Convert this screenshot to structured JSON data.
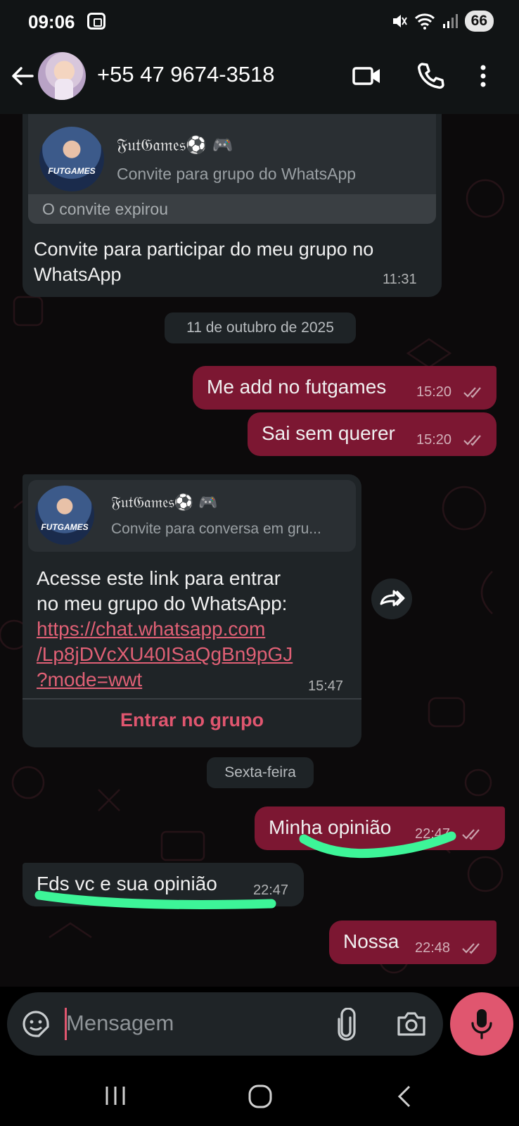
{
  "status": {
    "time": "09:06",
    "battery": "66"
  },
  "header": {
    "contact": "+55 47 9674-3518"
  },
  "messages": {
    "invite1": {
      "group_name": "𝔉𝔲𝔱𝔊𝔞𝔪𝔢𝔰⚽ 🎮",
      "subtitle": "Convite para grupo do WhatsApp",
      "thumb_label": "FUTGAMES",
      "expired": "O convite expirou",
      "text_line1": "Convite para participar do meu grupo no",
      "text_line2": "WhatsApp",
      "time": "11:31"
    },
    "date_chip_1": "11 de outubro de 2025",
    "out1": {
      "text": "Me add no futgames",
      "time": "15:20"
    },
    "out2": {
      "text": "Sai sem querer",
      "time": "15:20"
    },
    "invite2": {
      "group_name": "𝔉𝔲𝔱𝔊𝔞𝔪𝔢𝔰⚽ 🎮",
      "subtitle": "Convite para conversa em gru...",
      "thumb_label": "FUTGAMES",
      "line1": "Acesse este link para entrar",
      "line2": "no meu grupo do WhatsApp:",
      "link1": "https://chat.whatsapp.com",
      "link2": "/Lp8jDVcXU40ISaQgBn9pGJ",
      "link3": "?mode=wwt",
      "time": "15:47",
      "join_label": "Entrar no grupo"
    },
    "date_chip_2": "Sexta-feira",
    "out3": {
      "text": "Minha opinião",
      "time": "22:47"
    },
    "in1": {
      "text": "Fds vc e sua opinião",
      "time": "22:47"
    },
    "out4": {
      "text": "Nossa",
      "time": "22:48"
    }
  },
  "input": {
    "placeholder": "Mensagem"
  },
  "colors": {
    "outgoing": "#7c1732",
    "incoming": "#1f2427",
    "accent": "#e0566f",
    "highlight": "#3df598"
  },
  "icons": [
    "back-arrow-icon",
    "video-call-icon",
    "phone-icon",
    "more-options-icon",
    "forward-icon",
    "sticker-icon",
    "attach-icon",
    "camera-icon",
    "mic-icon",
    "recent-apps-icon",
    "home-icon",
    "nav-back-icon"
  ]
}
